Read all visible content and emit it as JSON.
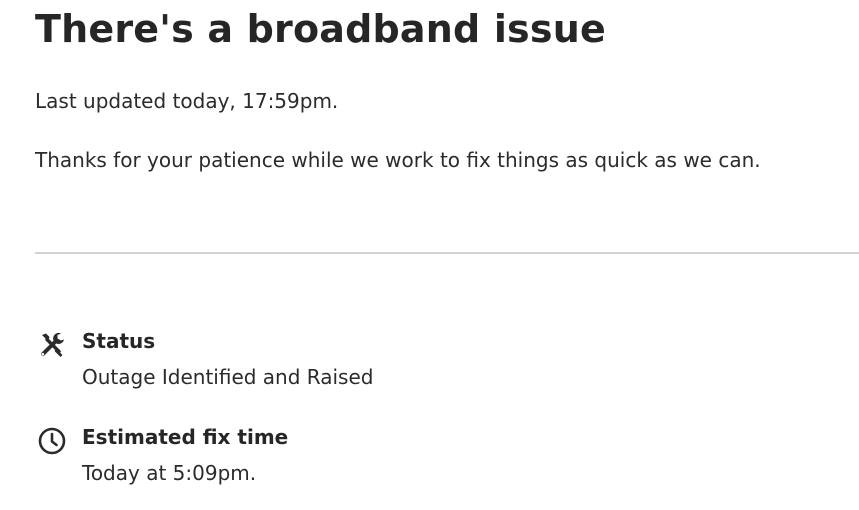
{
  "header": {
    "title": "There's a broadband issue"
  },
  "notice": {
    "last_updated": "Last updated today, 17:59pm.",
    "message": "Thanks for your patience while we work to fix things as quick as we can."
  },
  "details": {
    "status": {
      "icon": "tools-icon",
      "label": "Status",
      "value": "Outage Identified and Raised"
    },
    "fix_time": {
      "icon": "clock-icon",
      "label": "Estimated fix time",
      "value": "Today at 5:09pm."
    }
  },
  "colors": {
    "text": "#2b2b2b",
    "divider": "#d2d2d2",
    "background": "#ffffff"
  }
}
